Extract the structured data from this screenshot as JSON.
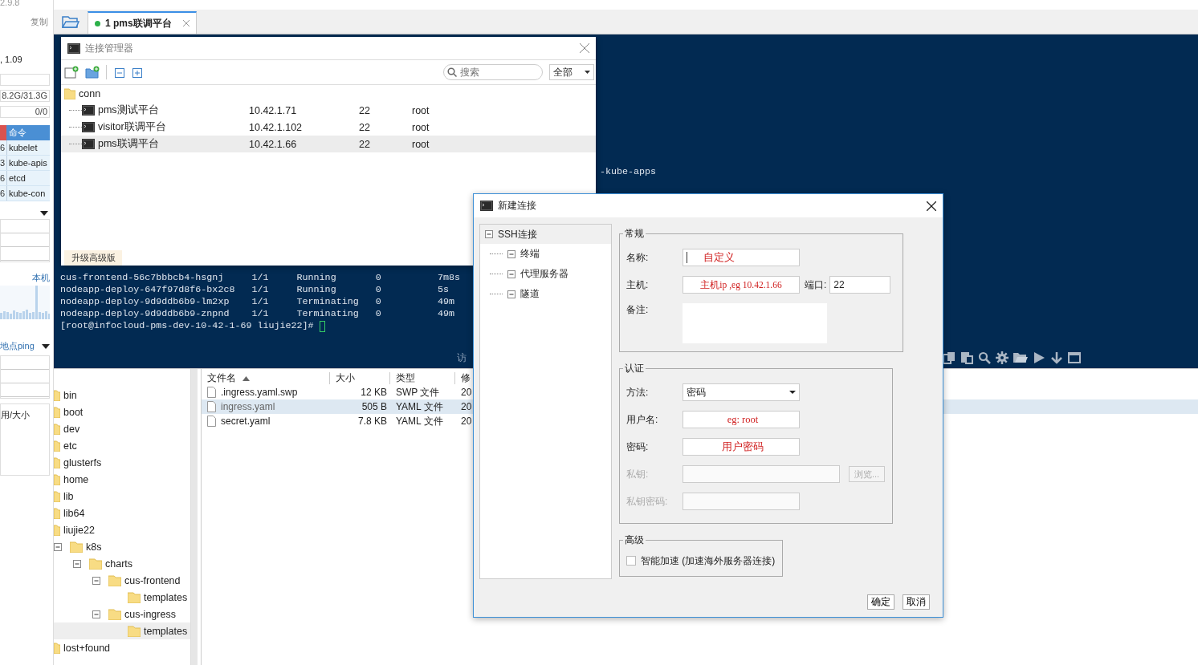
{
  "sidebar": {
    "version": "2.9.8",
    "copy_label": "复制",
    "load": ", 1.09",
    "memory": "8.2G/31.3G",
    "swap": "0/0",
    "process_table": {
      "header": "命令",
      "rows": [
        {
          "cpu": "6",
          "command": "kubelet"
        },
        {
          "cpu": "3",
          "command": "kube-apis"
        },
        {
          "cpu": "6",
          "command": "etcd"
        },
        {
          "cpu": "6",
          "command": "kube-con"
        }
      ]
    },
    "net_label": "本机",
    "ping_label": "地点ping",
    "disk_header": "用/大小"
  },
  "tabs": [
    {
      "label": "1 pms联调平台",
      "selected": true,
      "connected": true
    }
  ],
  "terminal": {
    "fragment": "-kube-apps",
    "rows": [
      [
        "cus-frontend-56c7bbbcb4-hsgnj",
        "1/1",
        "Running",
        "0",
        "7m8s"
      ],
      [
        "nodeapp-deploy-647f97d8f6-bx2c8",
        "1/1",
        "Running",
        "0",
        "5s"
      ],
      [
        "nodeapp-deploy-9d9ddb6b9-lm2xp",
        "1/1",
        "Terminating",
        "0",
        "49m"
      ],
      [
        "nodeapp-deploy-9d9ddb6b9-znpnd",
        "1/1",
        "Terminating",
        "0",
        "49m"
      ]
    ],
    "prompt": "[root@infocloud-pms-dev-10-42-1-69 liujie22]#",
    "side_label": "访"
  },
  "file_tree": [
    {
      "name": "bin",
      "selected": false
    },
    {
      "name": "boot",
      "selected": false
    },
    {
      "name": "dev",
      "selected": false
    },
    {
      "name": "etc",
      "selected": false
    },
    {
      "name": "glusterfs",
      "selected": false
    },
    {
      "name": "home",
      "selected": false
    },
    {
      "name": "lib",
      "selected": false
    },
    {
      "name": "lib64",
      "selected": false
    },
    {
      "name": "liujie22",
      "selected": false,
      "children": [
        {
          "name": "k8s",
          "selected": false,
          "expanded": true,
          "children": [
            {
              "name": "charts",
              "selected": false,
              "expanded": true,
              "children": [
                {
                  "name": "cus-frontend",
                  "selected": false,
                  "expanded": true,
                  "children": [
                    {
                      "name": "templates",
                      "selected": false
                    }
                  ]
                },
                {
                  "name": "cus-ingress",
                  "selected": false,
                  "expanded": true,
                  "children": [
                    {
                      "name": "templates",
                      "selected": true
                    }
                  ]
                }
              ]
            }
          ]
        }
      ]
    },
    {
      "name": "lost+found",
      "selected": false
    }
  ],
  "file_list": {
    "columns": [
      {
        "label": "文件名",
        "sorted": true
      },
      {
        "label": "大小"
      },
      {
        "label": "类型"
      },
      {
        "label": "修"
      }
    ],
    "files": [
      {
        "name": ".ingress.yaml.swp",
        "size": "12 KB",
        "type": "SWP 文件",
        "modified": "20",
        "selected": false
      },
      {
        "name": "ingress.yaml",
        "size": "505 B",
        "type": "YAML 文件",
        "modified": "20",
        "selected": true
      },
      {
        "name": "secret.yaml",
        "size": "7.8 KB",
        "type": "YAML 文件",
        "modified": "20",
        "selected": false
      }
    ]
  },
  "connection_manager": {
    "title": "连接管理器",
    "search_placeholder": "搜索",
    "filter": "全部",
    "folder": "conn",
    "sessions": [
      {
        "name": "pms测试平台",
        "host": "10.42.1.71",
        "port": "22",
        "user": "root",
        "selected": false
      },
      {
        "name": "visitor联调平台",
        "host": "10.42.1.102",
        "port": "22",
        "user": "root",
        "selected": false
      },
      {
        "name": "pms联调平台",
        "host": "10.42.1.66",
        "port": "22",
        "user": "root",
        "selected": true
      }
    ],
    "upgrade_label": "升级高级版"
  },
  "new_connection": {
    "title": "新建连接",
    "tree": [
      {
        "label": "SSH连接",
        "expanded": true,
        "selected": true,
        "children": [
          {
            "label": "终端",
            "expanded": true,
            "selected": false
          },
          {
            "label": "代理服务器",
            "expanded": true,
            "selected": false
          },
          {
            "label": "隧道",
            "expanded": true,
            "selected": false
          }
        ]
      }
    ],
    "general": {
      "title": "常规",
      "name_label": "名称:",
      "name_value": "自定义",
      "host_label": "主机:",
      "host_value": "主机ip ,eg 10.42.1.66",
      "port_label": "端口:",
      "port_value": "22",
      "note_label": "备注:"
    },
    "auth": {
      "title": "认证",
      "method_label": "方法:",
      "method_value": "密码",
      "user_label": "用户名:",
      "user_value": "eg: root",
      "password_label": "密码:",
      "password_value": "用户密码",
      "key_label": "私钥:",
      "key_disabled": true,
      "browse_label": "浏览...",
      "passphrase_label": "私钥密码:",
      "passphrase_disabled": true
    },
    "advanced": {
      "title": "高级",
      "accelerate_label": "智能加速 (加速海外服务器连接)",
      "checked": false
    },
    "buttons": [
      "确定",
      "取消"
    ]
  }
}
